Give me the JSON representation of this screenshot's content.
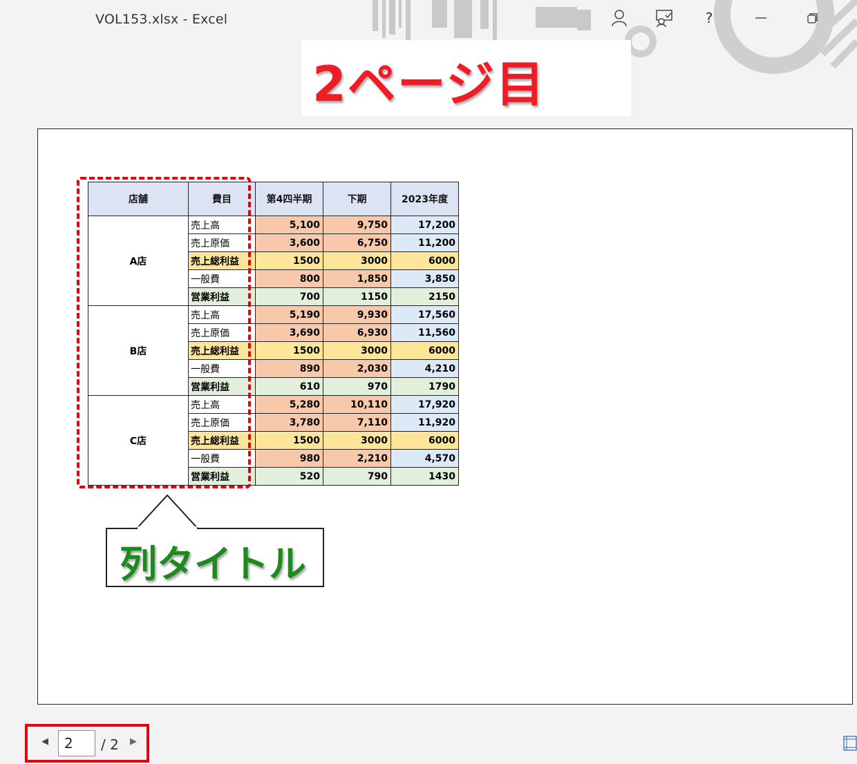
{
  "window": {
    "title": "VOL153.xlsx  -  Excel"
  },
  "banner": {
    "text": "2ページ目"
  },
  "table": {
    "headers": [
      "店舗",
      "費目",
      "第4四半期",
      "下期",
      "2023年度"
    ],
    "stores": [
      {
        "name": "A店",
        "rows": [
          {
            "item": "売上高",
            "q4": "5,100",
            "h2": "9,750",
            "fy": "17,200"
          },
          {
            "item": "売上原価",
            "q4": "3,600",
            "h2": "6,750",
            "fy": "11,200"
          },
          {
            "item": "売上総利益",
            "q4": "1500",
            "h2": "3000",
            "fy": "6000"
          },
          {
            "item": "一般費",
            "q4": "800",
            "h2": "1,850",
            "fy": "3,850"
          },
          {
            "item": "営業利益",
            "q4": "700",
            "h2": "1150",
            "fy": "2150"
          }
        ]
      },
      {
        "name": "B店",
        "rows": [
          {
            "item": "売上高",
            "q4": "5,190",
            "h2": "9,930",
            "fy": "17,560"
          },
          {
            "item": "売上原価",
            "q4": "3,690",
            "h2": "6,930",
            "fy": "11,560"
          },
          {
            "item": "売上総利益",
            "q4": "1500",
            "h2": "3000",
            "fy": "6000"
          },
          {
            "item": "一般費",
            "q4": "890",
            "h2": "2,030",
            "fy": "4,210"
          },
          {
            "item": "営業利益",
            "q4": "610",
            "h2": "970",
            "fy": "1790"
          }
        ]
      },
      {
        "name": "C店",
        "rows": [
          {
            "item": "売上高",
            "q4": "5,280",
            "h2": "10,110",
            "fy": "17,920"
          },
          {
            "item": "売上原価",
            "q4": "3,780",
            "h2": "7,110",
            "fy": "11,920"
          },
          {
            "item": "売上総利益",
            "q4": "1500",
            "h2": "3000",
            "fy": "6000"
          },
          {
            "item": "一般費",
            "q4": "980",
            "h2": "2,210",
            "fy": "4,570"
          },
          {
            "item": "営業利益",
            "q4": "520",
            "h2": "790",
            "fy": "1430"
          }
        ]
      }
    ]
  },
  "callout": {
    "text": "列タイトル"
  },
  "pager": {
    "current": "2",
    "total": "/ 2"
  },
  "colors": {
    "accent_red": "#e3000f",
    "banner_red": "#ee1c25",
    "callout_green": "#1e8a1e",
    "header_blue": "#dce3f2",
    "orange": "#f7c9aa",
    "blue": "#dce9f6",
    "yellow": "#fde59a",
    "green": "#e2efda"
  },
  "icons": [
    "account-icon",
    "comments-icon",
    "help-icon",
    "minimize-icon",
    "restore-icon",
    "prev-page-icon",
    "next-page-icon",
    "show-margins-icon"
  ]
}
